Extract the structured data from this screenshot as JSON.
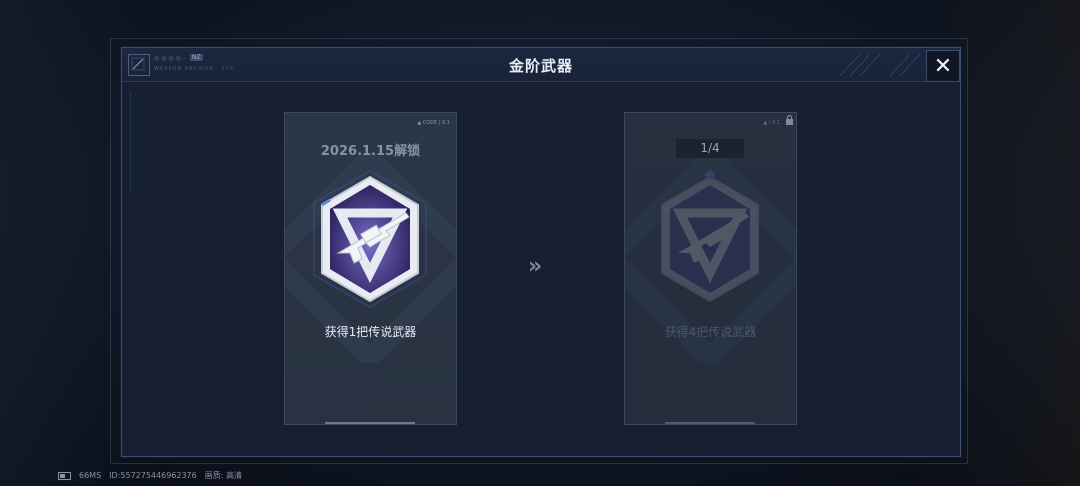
{
  "modal": {
    "title": "金阶武器",
    "close_glyph": "✕",
    "logo_text": "◎◎◎◎-",
    "logo_tag": "NZ",
    "logo_sub": "WEAPON ARCHIVE · SYS"
  },
  "cards": [
    {
      "unlock_date": "2026.1.15解锁",
      "requirement": "获得1把传说武器",
      "corner_tag": "▲ CODE | 0.1",
      "icon": "legendary-rifle-emblem-icon",
      "state": "locked-by-date"
    },
    {
      "progress": "1/4",
      "requirement": "获得4把传说武器",
      "corner_tag": "▲ / 0.1",
      "icon": "legendary-rifle-emblem-icon",
      "state": "locked"
    }
  ],
  "arrow_glyph": "»",
  "footer": {
    "ping": "66MS",
    "id": "ID:557275446962376",
    "quality": "画质: 高清"
  },
  "colors": {
    "accent_purple": "#5b4a9e",
    "emblem_silver": "#d8dde6",
    "panel_bg": "#162032"
  }
}
